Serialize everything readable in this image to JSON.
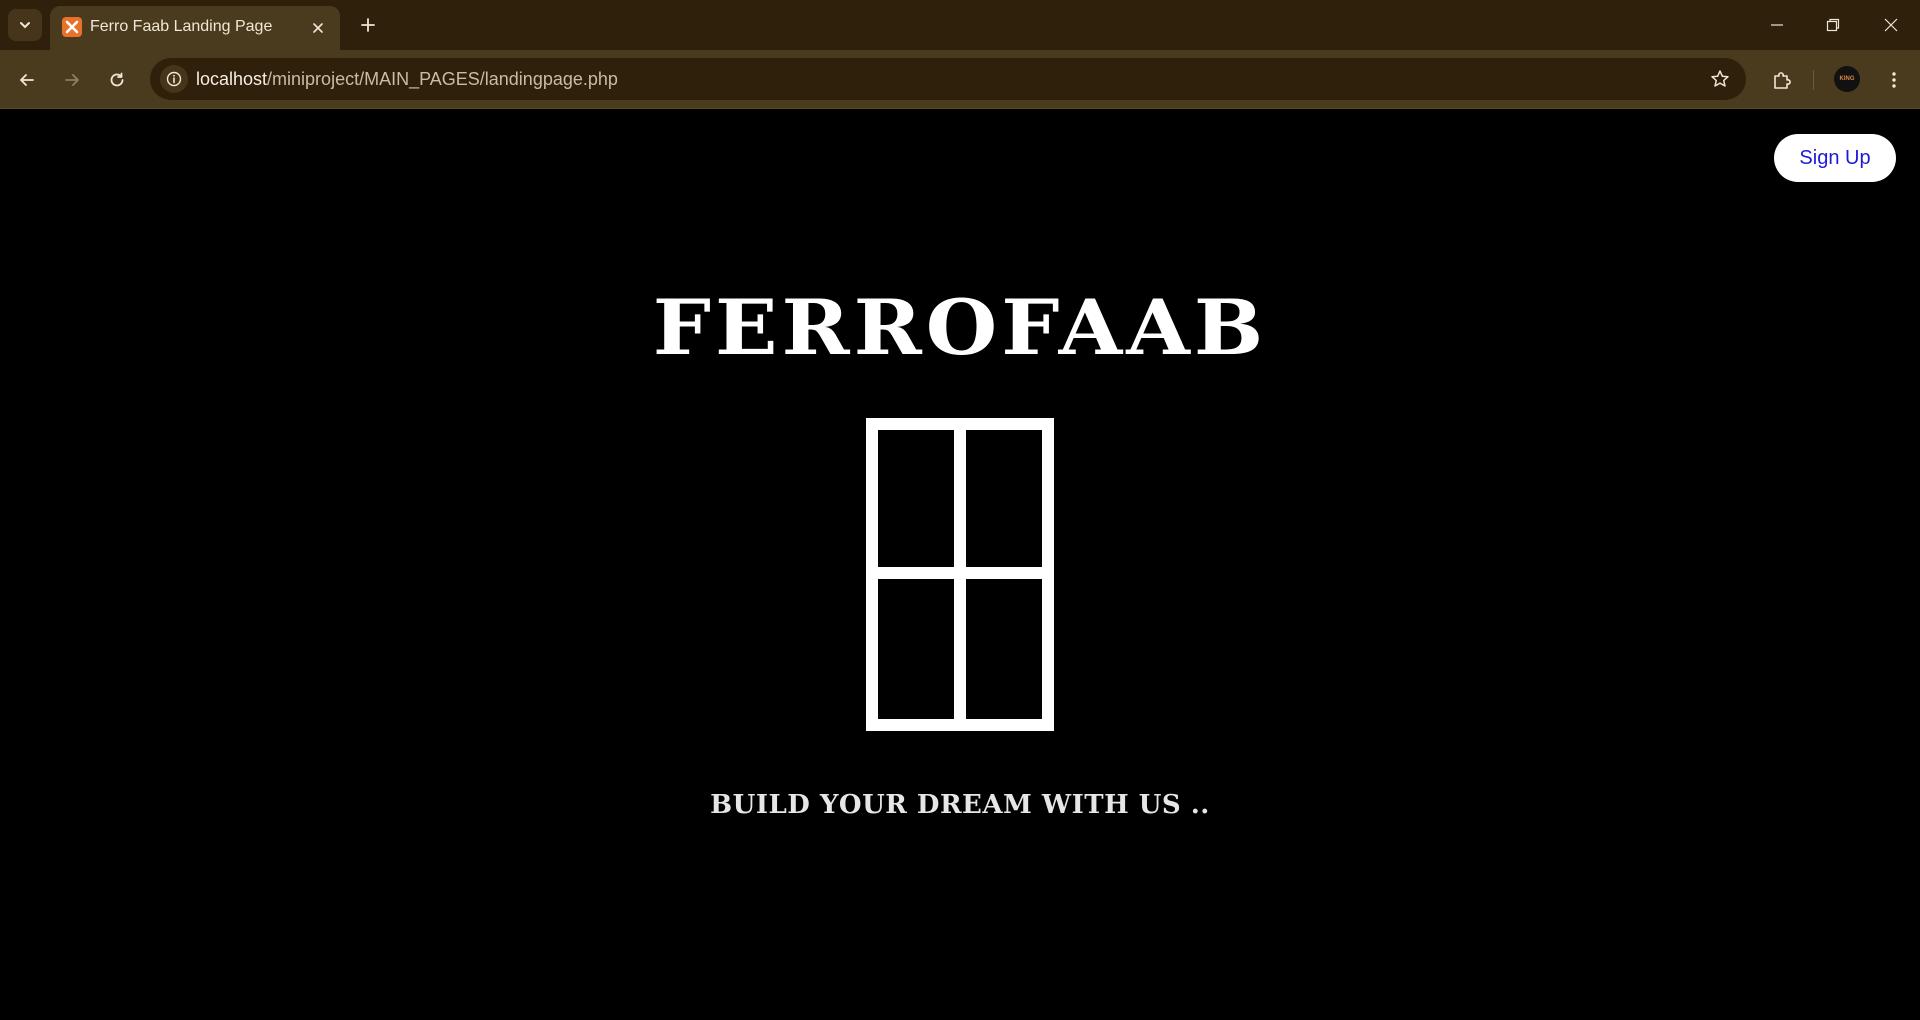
{
  "browser": {
    "tab": {
      "title": "Ferro Faab Landing Page"
    },
    "url": {
      "host": "localhost",
      "path": "/miniproject/MAIN_PAGES/landingpage.php"
    },
    "profile": {
      "label": "KING"
    },
    "colors": {
      "tabbar": "#2e200b",
      "toolbar": "#4a3a1e",
      "omnibox": "#2e200b"
    }
  },
  "page": {
    "signup_label": "Sign Up",
    "brand": "FERROFAAB",
    "tagline": "BUILD YOUR DREAM WITH US ..",
    "colors": {
      "background": "#000000",
      "foreground": "#ffffff",
      "signup_text": "#1f1ad6"
    },
    "logo_icon": "window-icon"
  }
}
